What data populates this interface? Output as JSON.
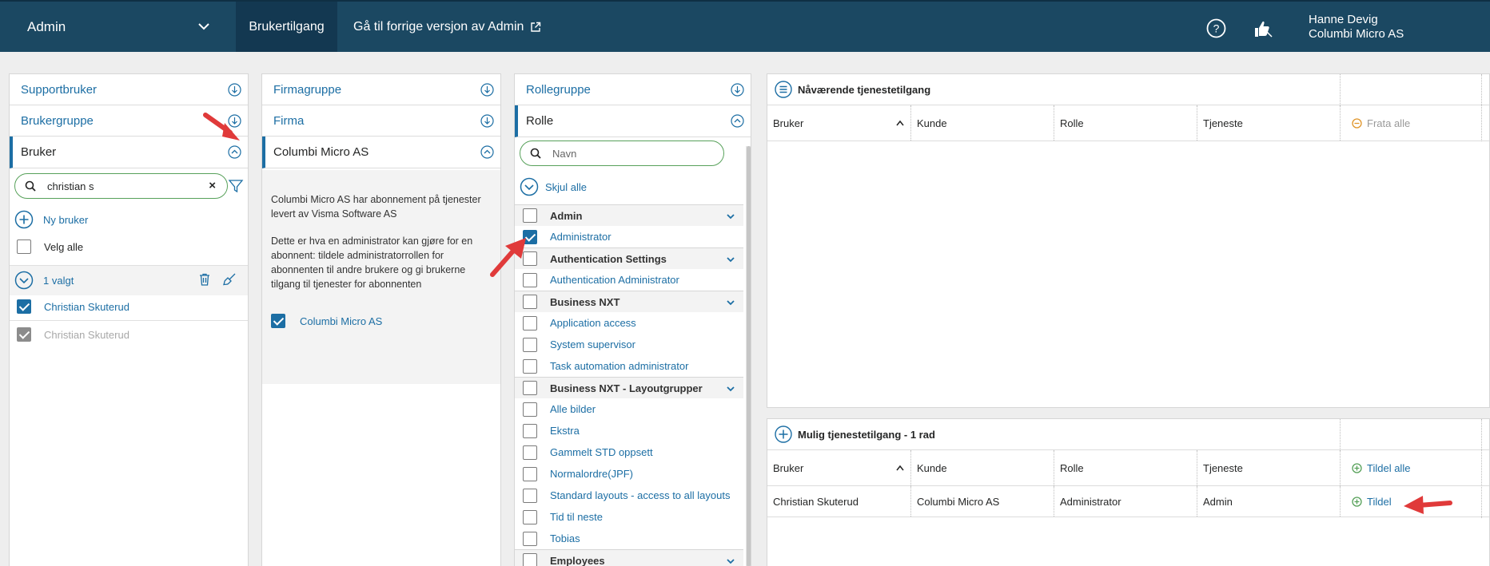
{
  "topbar": {
    "app_name": "Admin",
    "tab_active": "Brukertilgang",
    "tab_link": "Gå til forrige versjon av Admin",
    "user_name": "Hanne Devig",
    "user_company": "Columbi Micro AS"
  },
  "panel_users": {
    "rows": [
      "Supportbruker",
      "Brukergruppe",
      "Bruker"
    ],
    "search_value": "christian s",
    "new_user": "Ny bruker",
    "select_all": "Velg alle",
    "selected_count": "1 valgt",
    "users": [
      {
        "name": "Christian Skuterud",
        "checked": true,
        "disabled": false
      },
      {
        "name": "Christian Skuterud",
        "checked": true,
        "disabled": true
      }
    ]
  },
  "panel_company": {
    "rows": [
      "Firmagruppe",
      "Firma",
      "Columbi Micro AS"
    ],
    "info_p1": "Columbi Micro AS har abonnement på tjenester levert av Visma Software AS",
    "info_p2": "Dette er hva en administrator kan gjøre for en abonnent: tildele administratorrollen for abonnenten til andre brukere og gi brukerne tilgang til tjenester for abonnenten",
    "firm_checked": "Columbi Micro AS"
  },
  "panel_roles": {
    "rows": [
      "Rollegruppe",
      "Rolle"
    ],
    "search_placeholder": "Navn",
    "hide_all": "Skjul alle",
    "items": [
      {
        "type": "group",
        "label": "Admin"
      },
      {
        "type": "item",
        "label": "Administrator",
        "checked": true
      },
      {
        "type": "group",
        "label": "Authentication Settings"
      },
      {
        "type": "item",
        "label": "Authentication Administrator",
        "checked": false
      },
      {
        "type": "group",
        "label": "Business NXT"
      },
      {
        "type": "item",
        "label": "Application access",
        "checked": false
      },
      {
        "type": "item",
        "label": "System supervisor",
        "checked": false
      },
      {
        "type": "item",
        "label": "Task automation administrator",
        "checked": false
      },
      {
        "type": "group",
        "label": "Business NXT - Layoutgrupper"
      },
      {
        "type": "item",
        "label": "Alle bilder",
        "checked": false
      },
      {
        "type": "item",
        "label": "Ekstra",
        "checked": false
      },
      {
        "type": "item",
        "label": "Gammelt STD oppsett",
        "checked": false
      },
      {
        "type": "item",
        "label": "Normalordre(JPF)",
        "checked": false
      },
      {
        "type": "item",
        "label": "Standard layouts - access to all layouts",
        "checked": false
      },
      {
        "type": "item",
        "label": "Tid til neste",
        "checked": false
      },
      {
        "type": "item",
        "label": "Tobias",
        "checked": false
      },
      {
        "type": "group",
        "label": "Employees"
      }
    ]
  },
  "grid_current": {
    "title": "Nåværende tjenestetilgang",
    "columns": [
      "Bruker",
      "Kunde",
      "Rolle",
      "Tjeneste"
    ],
    "action_all": "Frata alle"
  },
  "grid_possible": {
    "title": "Mulig tjenestetilgang - 1 rad",
    "columns": [
      "Bruker",
      "Kunde",
      "Rolle",
      "Tjeneste"
    ],
    "action_all": "Tildel alle",
    "rows": [
      {
        "user": "Christian Skuterud",
        "customer": "Columbi Micro AS",
        "role": "Administrator",
        "service": "Admin",
        "action": "Tildel"
      }
    ]
  },
  "colors": {
    "header_bg": "#1b4862",
    "header_active": "#133851",
    "link_blue": "#1c6ea4",
    "accent_green": "#57a15a",
    "warn_orange": "#e0952a",
    "arrow_red": "#e03a3a"
  }
}
